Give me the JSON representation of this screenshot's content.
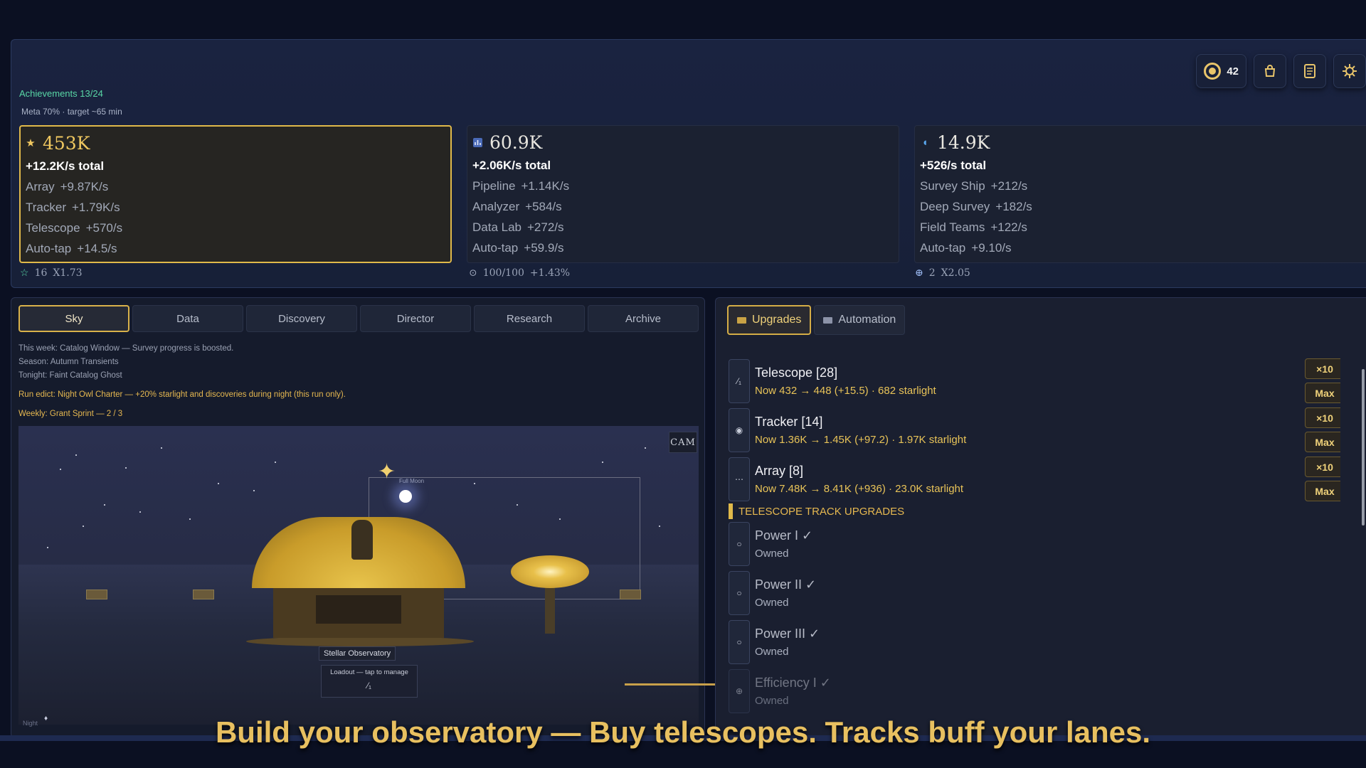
{
  "header": {
    "achievements": "Achievements 13/24",
    "meta": "Meta 70% · target ~65 min",
    "actions": {
      "tokens_count": "42"
    }
  },
  "lanes": [
    {
      "value": "453K",
      "total": "+12.2K/s total",
      "rows": [
        {
          "name": "Array",
          "rate": "+9.87K/s"
        },
        {
          "name": "Tracker",
          "rate": "+1.79K/s"
        },
        {
          "name": "Telescope",
          "rate": "+570/s"
        },
        {
          "name": "Auto-tap",
          "rate": "+14.5/s"
        }
      ],
      "foot_a": "16",
      "foot_b": "X1.73"
    },
    {
      "value": "60.9K",
      "total": "+2.06K/s total",
      "rows": [
        {
          "name": "Pipeline",
          "rate": "+1.14K/s"
        },
        {
          "name": "Analyzer",
          "rate": "+584/s"
        },
        {
          "name": "Data Lab",
          "rate": "+272/s"
        },
        {
          "name": "Auto-tap",
          "rate": "+59.9/s"
        }
      ],
      "foot_a": "100/100",
      "foot_b": "+1.43%"
    },
    {
      "value": "14.9K",
      "total": "+526/s total",
      "rows": [
        {
          "name": "Survey Ship",
          "rate": "+212/s"
        },
        {
          "name": "Deep Survey",
          "rate": "+182/s"
        },
        {
          "name": "Field Teams",
          "rate": "+122/s"
        },
        {
          "name": "Auto-tap",
          "rate": "+9.10/s"
        }
      ],
      "foot_a": "2",
      "foot_b": "X2.05"
    }
  ],
  "tabs": [
    "Sky",
    "Data",
    "Discovery",
    "Director",
    "Research",
    "Archive"
  ],
  "info": {
    "week": "This week: Catalog Window — Survey progress is boosted.",
    "season": "Season: Autumn Transients",
    "tonight": "Tonight: Faint Catalog Ghost",
    "edict": "Run edict: Night Owl Charter — +20% starlight and discoveries during night (this run only).",
    "weekly": "Weekly: Grant Sprint — 2 / 3"
  },
  "scene": {
    "cam": "CAM",
    "moon_label": "Full Moon",
    "observatory": "Stellar Observatory",
    "loadout": "Loadout — tap to manage",
    "night": "Night"
  },
  "right_tabs": [
    "Upgrades",
    "Automation"
  ],
  "producers": [
    {
      "name": "Telescope  [28]",
      "detail": "Now 432 → 448  (+15.5)  ·  682 starlight"
    },
    {
      "name": "Tracker  [14]",
      "detail": "Now 1.36K → 1.45K  (+97.2)  ·  1.97K starlight"
    },
    {
      "name": "Array  [8]",
      "detail": "Now 7.48K → 8.41K  (+936)  ·  23.0K starlight"
    }
  ],
  "buy": {
    "x10": "×10",
    "max": "Max"
  },
  "track_title": "TELESCOPE TRACK UPGRADES",
  "track": [
    {
      "name": "Power I  ✓",
      "detail": "Owned"
    },
    {
      "name": "Power II  ✓",
      "detail": "Owned"
    },
    {
      "name": "Power III  ✓",
      "detail": "Owned"
    },
    {
      "name": "Efficiency I  ✓",
      "detail": "Owned"
    }
  ],
  "caption": "Build your observatory — Buy telescopes. Tracks buff your lanes.",
  "colors": {
    "accent": "#e0b94a",
    "positive": "#59d7a6",
    "panel": "#1a2340"
  }
}
